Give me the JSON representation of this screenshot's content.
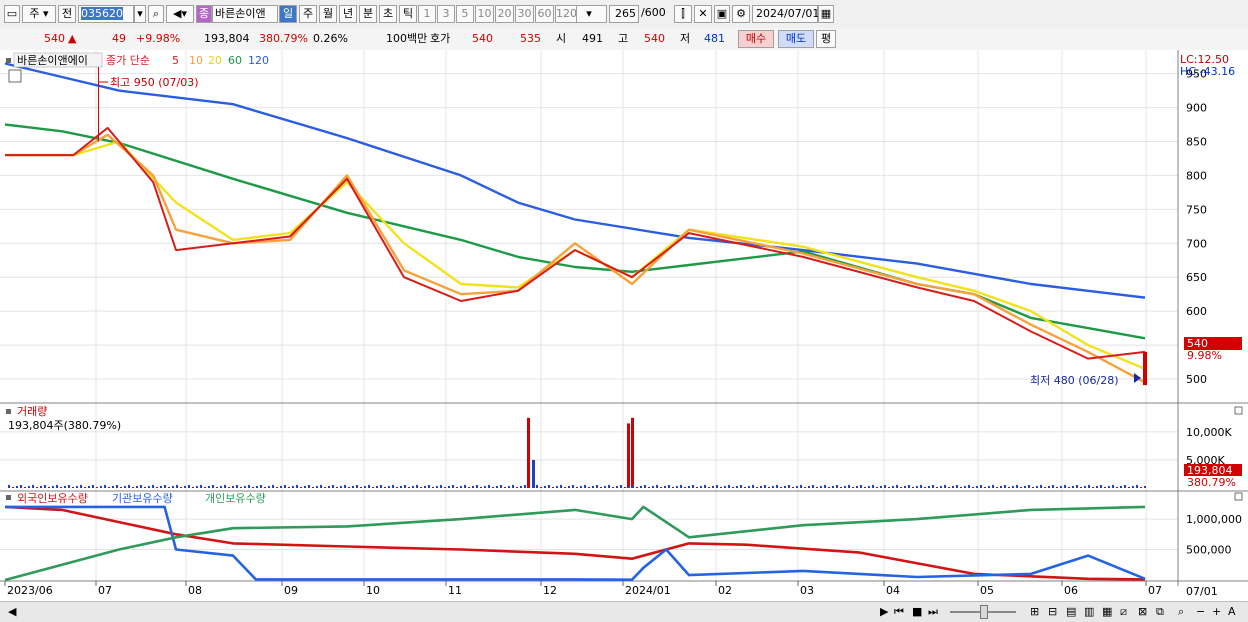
{
  "toolbar": {
    "market_type": "주",
    "prev_label": "전",
    "stock_code": "035620",
    "stock_name": "바른손이앤",
    "stock_badge": "종",
    "periods": [
      "일",
      "주",
      "월",
      "년",
      "분",
      "초",
      "틱"
    ],
    "active_period": "일",
    "intervals": [
      "1",
      "3",
      "5",
      "10",
      "20",
      "30",
      "60",
      "120"
    ],
    "range_value": "265",
    "range_total": "/600",
    "date": "2024/07/01"
  },
  "quote": {
    "price": "540",
    "change": "49",
    "change_pct": "+9.98%",
    "volume": "193,804",
    "volume_ratio": "380.79%",
    "turnover_pct": "0.26%",
    "unit": "100백만",
    "ask_label": "호가",
    "ask1": "540",
    "ask2": "535",
    "open_label": "시",
    "open": "491",
    "high_label": "고",
    "high": "540",
    "low_label": "저",
    "low": "481",
    "buy_label": "매수",
    "sell_label": "매도",
    "avg_label": "평"
  },
  "colors": {
    "up": "#d20000",
    "ma5": "#d71c1c",
    "ma10": "#f5a23c",
    "ma20": "#f2e21c",
    "ma60": "#1e9a46",
    "ma120": "#2b5de0",
    "vol_up": "#d20000",
    "vol_down": "#2040c0",
    "foreign": "#d21414",
    "institution": "#2464e0",
    "individual": "#2f9a5a"
  },
  "chart_data": [
    {
      "type": "candlestick",
      "legend_title": "바른손이앤에이",
      "legend": [
        "종가 단순",
        "5",
        "10",
        "20",
        "60",
        "120"
      ],
      "y_ticks": [
        500,
        550,
        600,
        650,
        700,
        750,
        800,
        850,
        900,
        950
      ],
      "ylim": [
        472,
        976
      ],
      "x_labels": [
        "2023/06",
        "07",
        "08",
        "09",
        "10",
        "11",
        "12",
        "2024/01",
        "02",
        "03",
        "04",
        "05",
        "06",
        "07"
      ],
      "top_right_label": "07/01",
      "lc_label": "LC:12.50",
      "hc_label": "HC:-43.16",
      "last_price": "540",
      "last_pct": "9.98%",
      "annotations": {
        "high": {
          "text": "최고 950 (07/03)",
          "value": 950,
          "date": "2023/07/03"
        },
        "low": {
          "text": "최저 480 (06/28)",
          "value": 480,
          "date": "2024/06/28"
        }
      },
      "series": [
        {
          "name": "120",
          "points": [
            [
              0,
              965
            ],
            [
              0.05,
              945
            ],
            [
              0.1,
              925
            ],
            [
              0.2,
              905
            ],
            [
              0.3,
              855
            ],
            [
              0.4,
              800
            ],
            [
              0.45,
              760
            ],
            [
              0.5,
              735
            ],
            [
              0.6,
              708
            ],
            [
              0.7,
              690
            ],
            [
              0.8,
              670
            ],
            [
              0.85,
              655
            ],
            [
              0.9,
              640
            ],
            [
              0.95,
              630
            ],
            [
              1,
              620
            ]
          ]
        },
        {
          "name": "60",
          "points": [
            [
              0,
              875
            ],
            [
              0.05,
              865
            ],
            [
              0.1,
              848
            ],
            [
              0.2,
              795
            ],
            [
              0.3,
              745
            ],
            [
              0.4,
              705
            ],
            [
              0.45,
              680
            ],
            [
              0.5,
              665
            ],
            [
              0.55,
              658
            ],
            [
              0.6,
              668
            ],
            [
              0.7,
              688
            ],
            [
              0.8,
              640
            ],
            [
              0.85,
              625
            ],
            [
              0.9,
              590
            ],
            [
              0.95,
              575
            ],
            [
              1,
              560
            ]
          ]
        },
        {
          "name": "20",
          "points": [
            [
              0,
              830
            ],
            [
              0.06,
              830
            ],
            [
              0.1,
              850
            ],
            [
              0.15,
              760
            ],
            [
              0.2,
              705
            ],
            [
              0.25,
              715
            ],
            [
              0.3,
              790
            ],
            [
              0.35,
              700
            ],
            [
              0.4,
              640
            ],
            [
              0.45,
              635
            ],
            [
              0.5,
              690
            ],
            [
              0.55,
              650
            ],
            [
              0.6,
              720
            ],
            [
              0.7,
              695
            ],
            [
              0.8,
              650
            ],
            [
              0.85,
              630
            ],
            [
              0.9,
              600
            ],
            [
              0.95,
              550
            ],
            [
              1,
              515
            ]
          ]
        },
        {
          "name": "10",
          "points": [
            [
              0,
              830
            ],
            [
              0.06,
              830
            ],
            [
              0.09,
              860
            ],
            [
              0.13,
              800
            ],
            [
              0.15,
              720
            ],
            [
              0.2,
              700
            ],
            [
              0.25,
              705
            ],
            [
              0.3,
              800
            ],
            [
              0.35,
              660
            ],
            [
              0.4,
              625
            ],
            [
              0.45,
              630
            ],
            [
              0.5,
              700
            ],
            [
              0.55,
              640
            ],
            [
              0.6,
              720
            ],
            [
              0.7,
              685
            ],
            [
              0.8,
              640
            ],
            [
              0.85,
              625
            ],
            [
              0.9,
              580
            ],
            [
              0.95,
              540
            ],
            [
              1,
              495
            ]
          ]
        },
        {
          "name": "5",
          "points": [
            [
              0,
              830
            ],
            [
              0.06,
              830
            ],
            [
              0.09,
              870
            ],
            [
              0.13,
              790
            ],
            [
              0.15,
              690
            ],
            [
              0.2,
              700
            ],
            [
              0.25,
              710
            ],
            [
              0.3,
              795
            ],
            [
              0.35,
              650
            ],
            [
              0.4,
              615
            ],
            [
              0.45,
              630
            ],
            [
              0.5,
              690
            ],
            [
              0.55,
              650
            ],
            [
              0.6,
              715
            ],
            [
              0.7,
              680
            ],
            [
              0.8,
              635
            ],
            [
              0.85,
              615
            ],
            [
              0.9,
              570
            ],
            [
              0.95,
              530
            ],
            [
              1,
              540
            ]
          ]
        }
      ]
    },
    {
      "type": "bar",
      "title": "거래량",
      "readout": "193,804주(380.79%)",
      "y_ticks": [
        "5,000K",
        "10,000K"
      ],
      "current": "193,804",
      "current_pct": "380.79%",
      "spikes": [
        {
          "date": "2023/11/30",
          "value": 12500,
          "up": true
        },
        {
          "date": "2023/12/01",
          "value": 5000,
          "up": false
        },
        {
          "date": "2024/01/05",
          "value": 11500,
          "up": true
        },
        {
          "date": "2024/01/08",
          "value": 12500,
          "up": true
        }
      ]
    },
    {
      "type": "line",
      "legend": [
        "외국인보유수량",
        "기관보유수량",
        "개인보유수량"
      ],
      "y_ticks": [
        "500,000",
        "1,000,000"
      ],
      "series": [
        {
          "name": "외국인보유수량",
          "points": [
            [
              0,
              1200000
            ],
            [
              0.05,
              1150000
            ],
            [
              0.1,
              950000
            ],
            [
              0.15,
              750000
            ],
            [
              0.2,
              600000
            ],
            [
              0.3,
              550000
            ],
            [
              0.4,
              500000
            ],
            [
              0.5,
              430000
            ],
            [
              0.55,
              350000
            ],
            [
              0.6,
              600000
            ],
            [
              0.65,
              580000
            ],
            [
              0.75,
              450000
            ],
            [
              0.85,
              100000
            ],
            [
              0.95,
              20000
            ],
            [
              1,
              10000
            ]
          ]
        },
        {
          "name": "기관보유수량",
          "points": [
            [
              0,
              1200000
            ],
            [
              0.14,
              1200000
            ],
            [
              0.15,
              500000
            ],
            [
              0.2,
              400000
            ],
            [
              0.22,
              10000
            ],
            [
              0.5,
              10000
            ],
            [
              0.55,
              5000
            ],
            [
              0.56,
              200000
            ],
            [
              0.58,
              500000
            ],
            [
              0.6,
              80000
            ],
            [
              0.7,
              150000
            ],
            [
              0.8,
              50000
            ],
            [
              0.9,
              100000
            ],
            [
              0.95,
              400000
            ],
            [
              1,
              20000
            ]
          ]
        },
        {
          "name": "개인보유수량",
          "points": [
            [
              0,
              0
            ],
            [
              0.05,
              250000
            ],
            [
              0.1,
              500000
            ],
            [
              0.15,
              700000
            ],
            [
              0.2,
              850000
            ],
            [
              0.3,
              880000
            ],
            [
              0.4,
              1000000
            ],
            [
              0.5,
              1150000
            ],
            [
              0.55,
              1000000
            ],
            [
              0.56,
              1200000
            ],
            [
              0.6,
              700000
            ],
            [
              0.7,
              900000
            ],
            [
              0.8,
              1000000
            ],
            [
              0.9,
              1150000
            ],
            [
              1,
              1200000
            ]
          ]
        }
      ]
    }
  ],
  "status": {
    "range_label": "2023/06",
    "end_label": "07"
  }
}
